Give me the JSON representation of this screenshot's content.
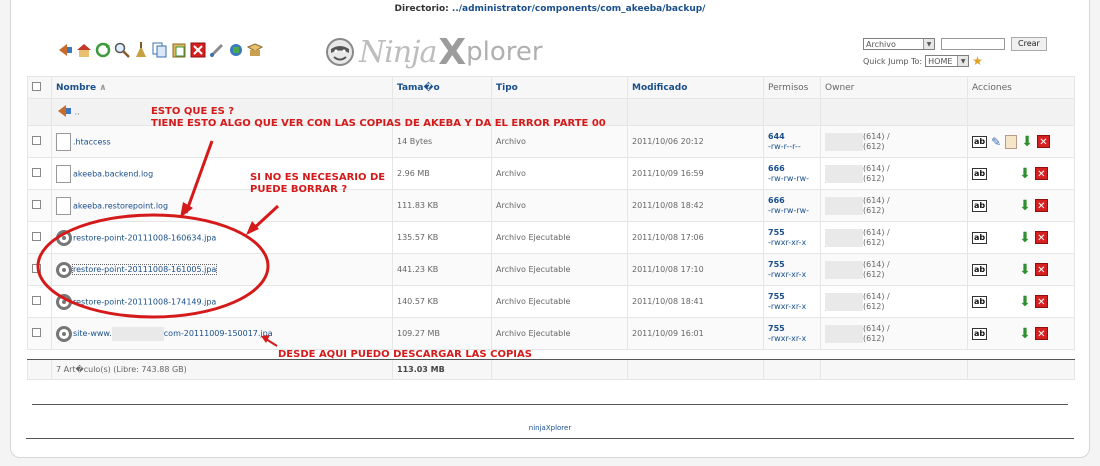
{
  "directory": {
    "label": "Directorio:",
    "path": "../administrator/components/com_akeeba/backup/"
  },
  "brand": {
    "part1": "Ninja",
    "part2": "X",
    "part3": "plorer"
  },
  "toolbar": {
    "icons": [
      "back-icon",
      "home-icon",
      "refresh-icon",
      "search-icon",
      "clean-icon",
      "copy-icon",
      "paste-icon",
      "delete-icon",
      "rename-icon",
      "permissions-icon",
      "archive-icon"
    ]
  },
  "create": {
    "type_value": "Archivo",
    "name_value": "",
    "create_button": "Crear",
    "quick_jump_label": "Quick Jump To:",
    "quick_jump_value": "HOME"
  },
  "table": {
    "columns": {
      "name": "Nombre",
      "size": "Tama�o",
      "type": "Tipo",
      "modified": "Modificado",
      "perms": "Permisos",
      "owner": "Owner",
      "actions": "Acciones"
    },
    "parent_label": "..",
    "rows": [
      {
        "name": ".htaccess",
        "icon": "file",
        "size": "14 Bytes",
        "type": "Archivo",
        "modified": "2011/10/06 20:12",
        "perm_num": "644",
        "perm_str": "-rw-r--r--",
        "owner_uid": "(614) /",
        "owner_gid": "(612)",
        "extra_actions": true
      },
      {
        "name": "akeeba.backend.log",
        "icon": "file",
        "size": "2.96 MB",
        "type": "Archivo",
        "modified": "2011/10/09 16:59",
        "perm_num": "666",
        "perm_str": "-rw-rw-rw-",
        "owner_uid": "(614) /",
        "owner_gid": "(612)",
        "extra_actions": false
      },
      {
        "name": "akeeba.restorepoint.log",
        "icon": "file",
        "size": "111.83 KB",
        "type": "Archivo",
        "modified": "2011/10/08 18:42",
        "perm_num": "666",
        "perm_str": "-rw-rw-rw-",
        "owner_uid": "(614) /",
        "owner_gid": "(612)",
        "extra_actions": false
      },
      {
        "name": "restore-point-20111008-160634.jpa",
        "icon": "gear",
        "size": "135.57 KB",
        "type": "Archivo Ejecutable",
        "modified": "2011/10/08 17:06",
        "perm_num": "755",
        "perm_str": "-rwxr-xr-x",
        "owner_uid": "(614) /",
        "owner_gid": "(612)",
        "extra_actions": false
      },
      {
        "name": "restore-point-20111008-161005.jpa",
        "icon": "gear",
        "size": "441.23 KB",
        "type": "Archivo Ejecutable",
        "modified": "2011/10/08 17:10",
        "perm_num": "755",
        "perm_str": "-rwxr-xr-x",
        "owner_uid": "(614) /",
        "owner_gid": "(612)",
        "extra_actions": false
      },
      {
        "name": "restore-point-20111008-174149.jpa",
        "icon": "gear",
        "size": "140.57 KB",
        "type": "Archivo Ejecutable",
        "modified": "2011/10/08 18:41",
        "perm_num": "755",
        "perm_str": "-rwxr-xr-x",
        "owner_uid": "(614) /",
        "owner_gid": "(612)",
        "extra_actions": false
      },
      {
        "name_prefix": "site-www.",
        "name_suffix": "com-20111009-150017.jpa",
        "icon": "gear",
        "size": "109.27 MB",
        "type": "Archivo Ejecutable",
        "modified": "2011/10/09 16:01",
        "perm_num": "755",
        "perm_str": "-rwxr-xr-x",
        "owner_uid": "(614) /",
        "owner_gid": "(612)",
        "extra_actions": false
      }
    ],
    "summary": {
      "items": "7 Art�culo(s) (Libre: 743.88 GB)",
      "total": "113.03 MB"
    }
  },
  "annotations": {
    "q1_line1": "ESTO QUE ES ?",
    "q1_line2": "TIENE ESTO ALGO QUE VER CON LAS COPIAS DE AKEBA Y DA EL ERROR PARTE 00",
    "q2_line1": "SI NO ES NECESARIO DE",
    "q2_line2": "PUEDE BORRAR ?",
    "note": "DESDE AQUI PUEDO DESCARGAR LAS COPIAS",
    "color": "#d41a1a"
  },
  "footer": {
    "text": "ninjaXplorer"
  }
}
